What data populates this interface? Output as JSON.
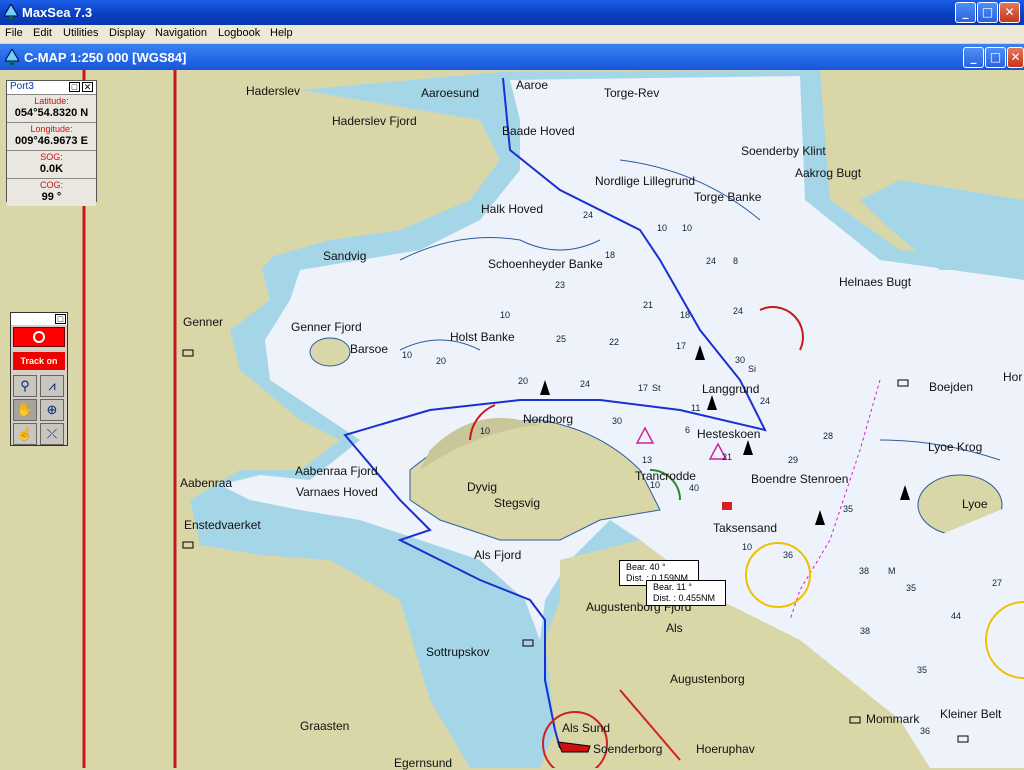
{
  "window": {
    "title": "MaxSea 7.3",
    "buttons": {
      "minimize": "_",
      "maximize": "□",
      "close": "✕"
    }
  },
  "menu": [
    "File",
    "Edit",
    "Utilities",
    "Display",
    "Navigation",
    "Logbook",
    "Help"
  ],
  "chart_window": {
    "title": "C-MAP  1:250 000 [WGS84]"
  },
  "position_panel": {
    "title": "Port3",
    "latitude_label": "Latitude:",
    "latitude": "054°54.8320 N",
    "longitude_label": "Longitude:",
    "longitude": "009°46.9673 E",
    "sog_label": "SOG:",
    "sog": "0.0K",
    "cog_label": "COG:",
    "cog": "99 °"
  },
  "toolbox": {
    "track_label": "Track on"
  },
  "bearings": [
    {
      "bear": "Bear.  40 °",
      "dist": "Dist. : 0.159NM"
    },
    {
      "bear": "Bear.  11 °",
      "dist": "Dist. : 0.455NM"
    }
  ],
  "place_names": [
    "Haderslev",
    "Aaroesund",
    "Aaroe",
    "Torge-Rev",
    "Haderslev Fjord",
    "Baade Hoved",
    "Soenderby Klint",
    "Nordlige Lillegrund",
    "Aakrog Bugt",
    "Torge Banke",
    "Halk Hoved",
    "Sandvig",
    "Schoenheyder Banke",
    "Helnaes Bugt",
    "Genner",
    "Genner Fjord",
    "Barsoe",
    "Holst Banke",
    "Langgrund",
    "Boejden",
    "Nordborg",
    "Hesteskoen",
    "Lyoe Krog",
    "Aabenraa Fjord",
    "Trancrodde",
    "Boendre Stenroen",
    "Aabenraa",
    "Varnaes Hoved",
    "Dyvig",
    "Stegsvig",
    "Lyoe",
    "Enstedvaerket",
    "Taksensand",
    "Als Fjord",
    "Augustenborg Fjord",
    "Als",
    "Sottrupskov",
    "Augustenborg",
    "Graasten",
    "Mommark",
    "Kleiner Belt",
    "Als Sund",
    "Soenderborg",
    "Hoeruphav",
    "Egernsund",
    "Hor"
  ],
  "soundings": [
    "24",
    "10",
    "10",
    "24",
    "8",
    "18",
    "24",
    "23",
    "21",
    "18",
    "25",
    "22",
    "17",
    "17",
    "St",
    "24",
    "30",
    "11",
    "30",
    "6",
    "13",
    "40",
    "29",
    "28",
    "35",
    "36",
    "38",
    "M",
    "35",
    "44",
    "27",
    "38",
    "35",
    "36",
    "24",
    "Si",
    "21",
    "10"
  ],
  "depth_contours": [
    "10",
    "20",
    "20",
    "10",
    "10",
    "10"
  ],
  "colors": {
    "land": "#d9d7a8",
    "shallow": "#a4d6e8",
    "water": "#eef3fb",
    "route": "#1a2fd0",
    "border": "#c81818"
  }
}
